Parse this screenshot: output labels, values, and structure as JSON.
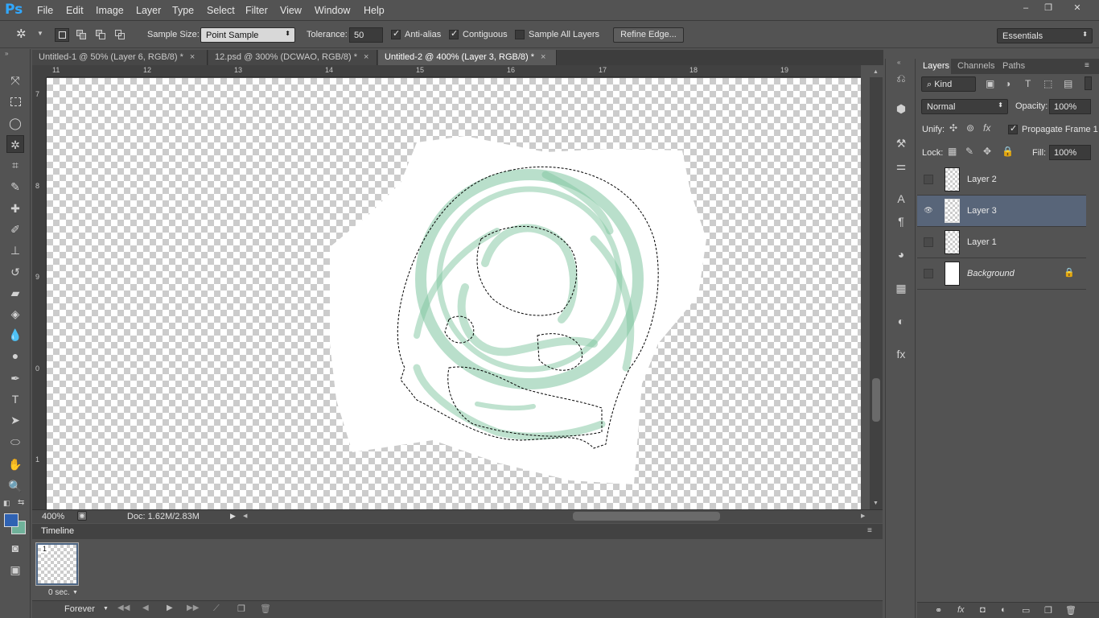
{
  "app": {
    "logo": "Ps"
  },
  "menu": [
    "File",
    "Edit",
    "Image",
    "Layer",
    "Type",
    "Select",
    "Filter",
    "View",
    "Window",
    "Help"
  ],
  "window_controls": {
    "minimize": "–",
    "restore": "❐",
    "close": "✕"
  },
  "options": {
    "sample_size_label": "Sample Size:",
    "sample_size_value": "Point Sample",
    "tolerance_label": "Tolerance:",
    "tolerance_value": "50",
    "anti_alias": "Anti-alias",
    "contiguous": "Contiguous",
    "sample_all_layers": "Sample All Layers",
    "refine_edge": "Refine Edge...",
    "workspace": "Essentials"
  },
  "tabs": [
    {
      "label": "Untitled-1 @ 50% (Layer 6, RGB/8) *",
      "active": false
    },
    {
      "label": "12.psd @ 300% (DCWAO, RGB/8) *",
      "active": false
    },
    {
      "label": "Untitled-2 @ 400% (Layer 3, RGB/8) *",
      "active": true
    }
  ],
  "ruler": {
    "h": [
      "11",
      "12",
      "13",
      "14",
      "15",
      "16",
      "17",
      "18",
      "19"
    ],
    "v": [
      "7",
      "8",
      "9",
      "0",
      "1"
    ]
  },
  "status": {
    "zoom": "400%",
    "doc": "Doc: 1.62M/2.83M"
  },
  "timeline": {
    "title": "Timeline",
    "frame_number": "1",
    "frame_delay": "0 sec.",
    "loop": "Forever"
  },
  "layers_panel": {
    "tabs": [
      "Layers",
      "Channels",
      "Paths"
    ],
    "filter_kind": "Kind",
    "blend_mode": "Normal",
    "opacity_label": "Opacity:",
    "opacity_value": "100%",
    "unify_label": "Unify:",
    "propagate": "Propagate Frame 1",
    "lock_label": "Lock:",
    "fill_label": "Fill:",
    "fill_value": "100%",
    "layers": [
      {
        "name": "Layer 2",
        "visible": false,
        "selected": false
      },
      {
        "name": "Layer 3",
        "visible": true,
        "selected": true
      },
      {
        "name": "Layer 1",
        "visible": false,
        "selected": false
      },
      {
        "name": "Background",
        "visible": false,
        "selected": false,
        "locked": true
      }
    ]
  },
  "colors": {
    "foreground": "#2f62b3",
    "background": "#6fb19a",
    "drawing": "#7fc5a0"
  }
}
